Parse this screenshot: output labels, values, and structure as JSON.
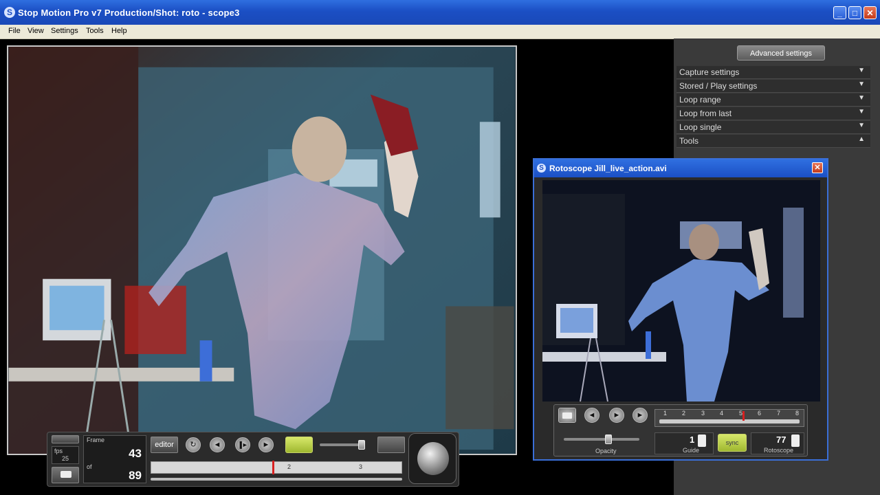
{
  "window": {
    "title": "Stop Motion Pro v7   Production/Shot: roto - scope3",
    "app_icon": "S",
    "minimize": "_",
    "maximize": "□",
    "close": "✕"
  },
  "menu": {
    "items": [
      {
        "label": "File"
      },
      {
        "label": "View"
      },
      {
        "label": "Settings"
      },
      {
        "label": "Tools"
      },
      {
        "label": "Help"
      }
    ]
  },
  "side_panel": {
    "advanced_label": "Advanced settings",
    "items": [
      {
        "label": "Capture settings",
        "arrow": "▼"
      },
      {
        "label": "Stored / Play settings",
        "arrow": "▼"
      },
      {
        "label": "Loop range",
        "arrow": "▼"
      },
      {
        "label": "Loop from last",
        "arrow": "▼"
      },
      {
        "label": "Loop single",
        "arrow": "▼"
      },
      {
        "label": "Tools",
        "arrow": "▲"
      }
    ]
  },
  "controls": {
    "fps_label": "fps",
    "fps_value": "25",
    "frame_label": "Frame",
    "frame_value": "43",
    "total_label": "of",
    "total_value": "89",
    "editor_label": "editor",
    "play_icon": "►",
    "prev_icon": "◄",
    "loop_icon": "↻",
    "step_icon": "▐►",
    "timeline_marks": [
      "2",
      "3"
    ],
    "playhead_fraction": 0.48
  },
  "rotoscope": {
    "title": "Rotoscope   Jill_live_action.avi",
    "close": "✕",
    "ruler_ticks": [
      "1",
      "2",
      "3",
      "4",
      "5",
      "6",
      "7",
      "8"
    ],
    "playhead_tick": "5",
    "opacity_label": "Opacity",
    "guide_label": "Guide",
    "guide_value": "1",
    "sync_label": "sync",
    "rotoscope_label": "Rotoscope",
    "rotoscope_value": "77",
    "opacity_fraction": 0.6,
    "icons": {
      "open": "folder-icon",
      "prev": "◄",
      "play": "►",
      "next": "►"
    }
  }
}
